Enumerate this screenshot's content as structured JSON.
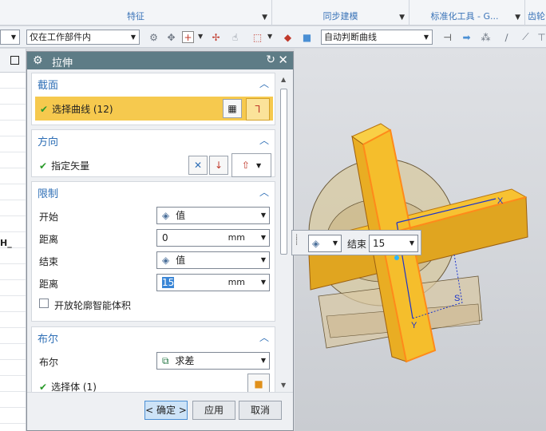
{
  "ribbon": {
    "groups": [
      {
        "label": "特征"
      },
      {
        "label": "同步建模"
      },
      {
        "label": "标准化工具 - G..."
      },
      {
        "label": "齿轮"
      }
    ]
  },
  "toolbar": {
    "filter_value": "仅在工作部件内",
    "curve_rule_value": "自动判断曲线"
  },
  "navigator": {
    "partial_label": "H_"
  },
  "dialog": {
    "title": "拉伸",
    "sections": {
      "section": {
        "title": "截面",
        "select_curve_label": "选择曲线 (12)"
      },
      "direction": {
        "title": "方向",
        "specify_vector_label": "指定矢量"
      },
      "limits": {
        "title": "限制",
        "start_label": "开始",
        "start_value": "值",
        "distance1_label": "距离",
        "distance1_value": "0",
        "distance1_unit": "mm",
        "end_label": "结束",
        "end_value": "值",
        "distance2_label": "距离",
        "distance2_value": "15",
        "distance2_unit": "mm",
        "open_profile_label": "开放轮廓智能体积"
      },
      "boolean": {
        "title": "布尔",
        "boolean_label": "布尔",
        "boolean_value": "求差",
        "select_body_label": "选择体 (1)"
      }
    },
    "buttons": {
      "ok": "< 确定 >",
      "apply": "应用",
      "cancel": "取消"
    }
  },
  "popup": {
    "end_label": "结束",
    "end_value": "15"
  },
  "viewport": {
    "axis_x": "X",
    "axis_y": "Y",
    "axis_s": "S"
  },
  "colors": {
    "accent": "#2f6fb6",
    "selection": "#f6c94e",
    "title_bar": "#5e7c86",
    "check": "#2a9a2a"
  }
}
